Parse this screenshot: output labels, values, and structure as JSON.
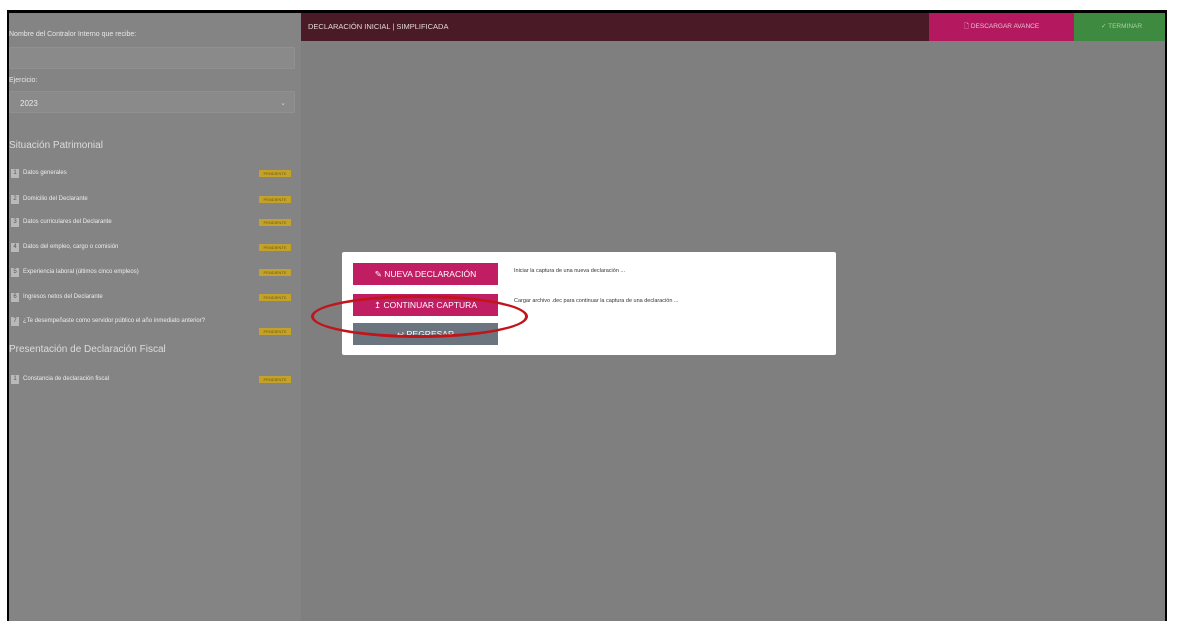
{
  "sidebar": {
    "receiver_label": "Nombre del Contralor Interno que recibe:",
    "receiver_value": "",
    "ejercicio_label": "Ejercicio:",
    "ejercicio_value": "2023",
    "situacion_title": "Situación Patrimonial",
    "situacion_items": [
      {
        "num": "1",
        "label": "Datos generales",
        "status": "PENDIENTE"
      },
      {
        "num": "2",
        "label": "Domicilio del Declarante",
        "status": "PENDIENTE"
      },
      {
        "num": "3",
        "label": "Datos curriculares del Declarante",
        "status": "PENDIENTE"
      },
      {
        "num": "4",
        "label": "Datos del empleo, cargo o comisión",
        "status": "PENDIENTE"
      },
      {
        "num": "5",
        "label": "Experiencia laboral (últimos cinco empleos)",
        "status": "PENDIENTE"
      },
      {
        "num": "6",
        "label": "Ingresos netos del Declarante",
        "status": "PENDIENTE"
      },
      {
        "num": "7",
        "label": "¿Te desempeñaste como servidor público el año inmediato anterior?",
        "status": "PENDIENTE"
      }
    ],
    "fiscal_title": "Presentación de Declaración Fiscal",
    "fiscal_items": [
      {
        "num": "1",
        "label": "Constancia de declaración fiscal",
        "status": "PENDIENTE"
      }
    ]
  },
  "header": {
    "title": "DECLARACIÓN INICIAL | SIMPLIFICADA",
    "download_label": "DESCARGAR AVANCE",
    "finish_label": "TERMINAR"
  },
  "modal": {
    "new_button": "NUEVA DECLARACIÓN",
    "new_desc": "Iniciar la captura de una nueva declaración ...",
    "continue_button": "CONTINUAR CAPTURA",
    "continue_desc": "Cargar archivo .dec para continuar la captura de una declaración ...",
    "back_button": "REGRESAR"
  },
  "colors": {
    "header_bg": "#4a1a27",
    "accent_pink": "#c01d63",
    "finish_green": "#3d8a40",
    "badge_yellow": "#c4a22a",
    "annotation_red": "#c0161b"
  },
  "icons": {
    "new": "pencil-icon",
    "continue": "upload-icon",
    "back": "return-arrow-icon",
    "download": "file-icon",
    "finish": "check-icon"
  }
}
